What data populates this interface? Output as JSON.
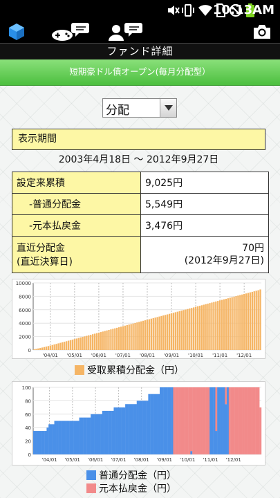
{
  "status_bar": {
    "time": "10:13AM"
  },
  "header": {
    "title": "ファンド詳細",
    "fund_name": "短期豪ドル債オープン(毎月分配型）"
  },
  "selector": {
    "value": "分配"
  },
  "period": {
    "label": "表示期間",
    "range": "2003年4月18日 〜 2012年9月27日"
  },
  "summary": {
    "rows": [
      {
        "label": "設定来累積",
        "value": "9,025円"
      },
      {
        "label": "-普通分配金",
        "value": "5,549円"
      },
      {
        "label": "-元本払戻金",
        "value": "3,476円"
      }
    ],
    "latest": {
      "label_line1": "直近分配金",
      "label_line2": "(直近決算日)",
      "value_line1": "70円",
      "value_line2": "(2012年9月27日)"
    }
  },
  "colors": {
    "cumulative": "#f5b565",
    "ordinary": "#4a90e8",
    "principal": "#f28a8a",
    "fund_bar": "#5cc84c"
  },
  "icons": [
    "hexagon-icon",
    "gamepad-chat-icon",
    "person-chat-icon",
    "camera-icon"
  ],
  "chart_data": [
    {
      "type": "bar",
      "legend": "受取累積分配金（円）",
      "ylim": [
        0,
        10000
      ],
      "yticks": [
        "10000",
        "8000",
        "6000",
        "4000",
        "2000",
        "0"
      ],
      "xticks": [
        "'04/01",
        "'05/01",
        "'06/01",
        "'07/01",
        "'08/01",
        "'09/01",
        "'10/01",
        "'11/01",
        "'12/01"
      ],
      "x": {
        "start": "2003-05",
        "end": "2012-09",
        "count": 113
      },
      "values_endpoints": {
        "first": 100,
        "last": 9025
      },
      "values": [
        100,
        160,
        230,
        300,
        370,
        440,
        510,
        590,
        670,
        750,
        830,
        910,
        990,
        1070,
        1150,
        1230,
        1310,
        1390,
        1470,
        1550,
        1630,
        1710,
        1790,
        1870,
        1950,
        2030,
        2110,
        2190,
        2270,
        2350,
        2430,
        2510,
        2590,
        2670,
        2750,
        2830,
        2910,
        2990,
        3070,
        3150,
        3230,
        3310,
        3390,
        3470,
        3550,
        3630,
        3710,
        3790,
        3870,
        3950,
        4030,
        4110,
        4190,
        4270,
        4350,
        4430,
        4510,
        4590,
        4670,
        4750,
        4830,
        4910,
        4990,
        5070,
        5150,
        5230,
        5310,
        5390,
        5470,
        5550,
        5630,
        5710,
        5790,
        5870,
        5950,
        6030,
        6110,
        6190,
        6270,
        6350,
        6430,
        6510,
        6590,
        6670,
        6750,
        6830,
        6910,
        6990,
        7070,
        7150,
        7230,
        7310,
        7390,
        7470,
        7550,
        7630,
        7710,
        7790,
        7870,
        7950,
        8030,
        8110,
        8190,
        8270,
        8350,
        8430,
        8510,
        8590,
        8670,
        8750,
        8825,
        8905,
        9025
      ]
    },
    {
      "type": "bar",
      "stacked": true,
      "ylim": [
        0,
        100
      ],
      "yticks": [
        "100",
        "80",
        "60",
        "40",
        "20",
        "0"
      ],
      "xticks": [
        "'04/01",
        "'05/01",
        "'06/01",
        "'07/01",
        "'08/01",
        "'09/01",
        "'10/01",
        "'11/01",
        "'12/01"
      ],
      "series": [
        {
          "name": "普通分配金（円）",
          "color": "#4a90e8"
        },
        {
          "name": "元本払戻金（円）",
          "color": "#f28a8a"
        }
      ],
      "ordinary_values": [
        35,
        35,
        35,
        35,
        35,
        35,
        35,
        40,
        45,
        45,
        45,
        50,
        50,
        50,
        50,
        50,
        50,
        50,
        50,
        50,
        50,
        50,
        50,
        50,
        55,
        55,
        55,
        55,
        55,
        55,
        60,
        60,
        60,
        60,
        60,
        60,
        65,
        65,
        65,
        65,
        65,
        65,
        70,
        70,
        70,
        70,
        70,
        70,
        75,
        75,
        75,
        75,
        75,
        75,
        80,
        80,
        80,
        80,
        80,
        80,
        90,
        90,
        90,
        90,
        90,
        90,
        100,
        100,
        100,
        100,
        100,
        100,
        100,
        0,
        0,
        0,
        0,
        0,
        0,
        0,
        0,
        0,
        5,
        0,
        0,
        0,
        0,
        0,
        0,
        0,
        0,
        0,
        100,
        100,
        100,
        35,
        100,
        100,
        100,
        100,
        75,
        100,
        0,
        0,
        0,
        0,
        0,
        0,
        0,
        0,
        0,
        0,
        0,
        0,
        0,
        0,
        0,
        0,
        0
      ],
      "principal_values": [
        0,
        0,
        0,
        0,
        0,
        0,
        0,
        0,
        0,
        0,
        0,
        0,
        0,
        0,
        0,
        0,
        0,
        0,
        0,
        0,
        0,
        0,
        0,
        0,
        0,
        0,
        0,
        0,
        0,
        0,
        0,
        0,
        0,
        0,
        0,
        0,
        0,
        0,
        0,
        0,
        0,
        0,
        0,
        0,
        0,
        0,
        0,
        0,
        0,
        0,
        0,
        0,
        0,
        0,
        0,
        0,
        0,
        0,
        0,
        0,
        0,
        0,
        0,
        0,
        0,
        0,
        0,
        0,
        0,
        0,
        0,
        0,
        0,
        100,
        100,
        100,
        100,
        100,
        100,
        100,
        100,
        100,
        95,
        100,
        100,
        100,
        100,
        100,
        100,
        100,
        100,
        100,
        0,
        0,
        0,
        65,
        0,
        0,
        0,
        0,
        25,
        0,
        100,
        100,
        100,
        100,
        100,
        100,
        100,
        100,
        100,
        100,
        100,
        100,
        100,
        100,
        100,
        100,
        70
      ]
    }
  ]
}
